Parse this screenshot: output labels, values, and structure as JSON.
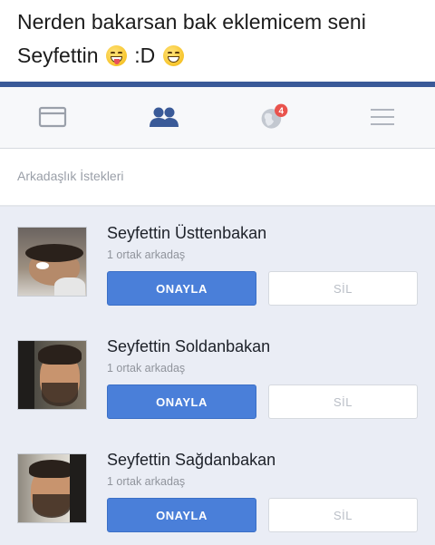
{
  "caption": {
    "line1": "Nerden bakarsan bak eklemicem seni",
    "line2_text": "Seyfettin",
    "line2_mid": ":D",
    "emoji1": "grinning-tongue-face-emoji",
    "emoji2": "grinning-face-emoji"
  },
  "tabs": [
    {
      "name": "news-feed-icon"
    },
    {
      "name": "friend-requests-icon",
      "active": true
    },
    {
      "name": "notifications-globe-icon",
      "badge": "4"
    },
    {
      "name": "menu-icon"
    }
  ],
  "section": {
    "title": "Arkadaşlık İstekleri"
  },
  "requests": [
    {
      "name": "Seyfettin Üsttenbakan",
      "mutual": "1 ortak arkadaş",
      "confirm": "ONAYLA",
      "delete": "SİL"
    },
    {
      "name": "Seyfettin Soldanbakan",
      "mutual": "1 ortak arkadaş",
      "confirm": "ONAYLA",
      "delete": "SİL"
    },
    {
      "name": "Seyfettin Sağdanbakan",
      "mutual": "1 ortak arkadaş",
      "confirm": "ONAYLA",
      "delete": "SİL"
    }
  ],
  "colors": {
    "brand": "#3a5a98",
    "confirm": "#4a7fd9",
    "badge": "#e9534d"
  }
}
